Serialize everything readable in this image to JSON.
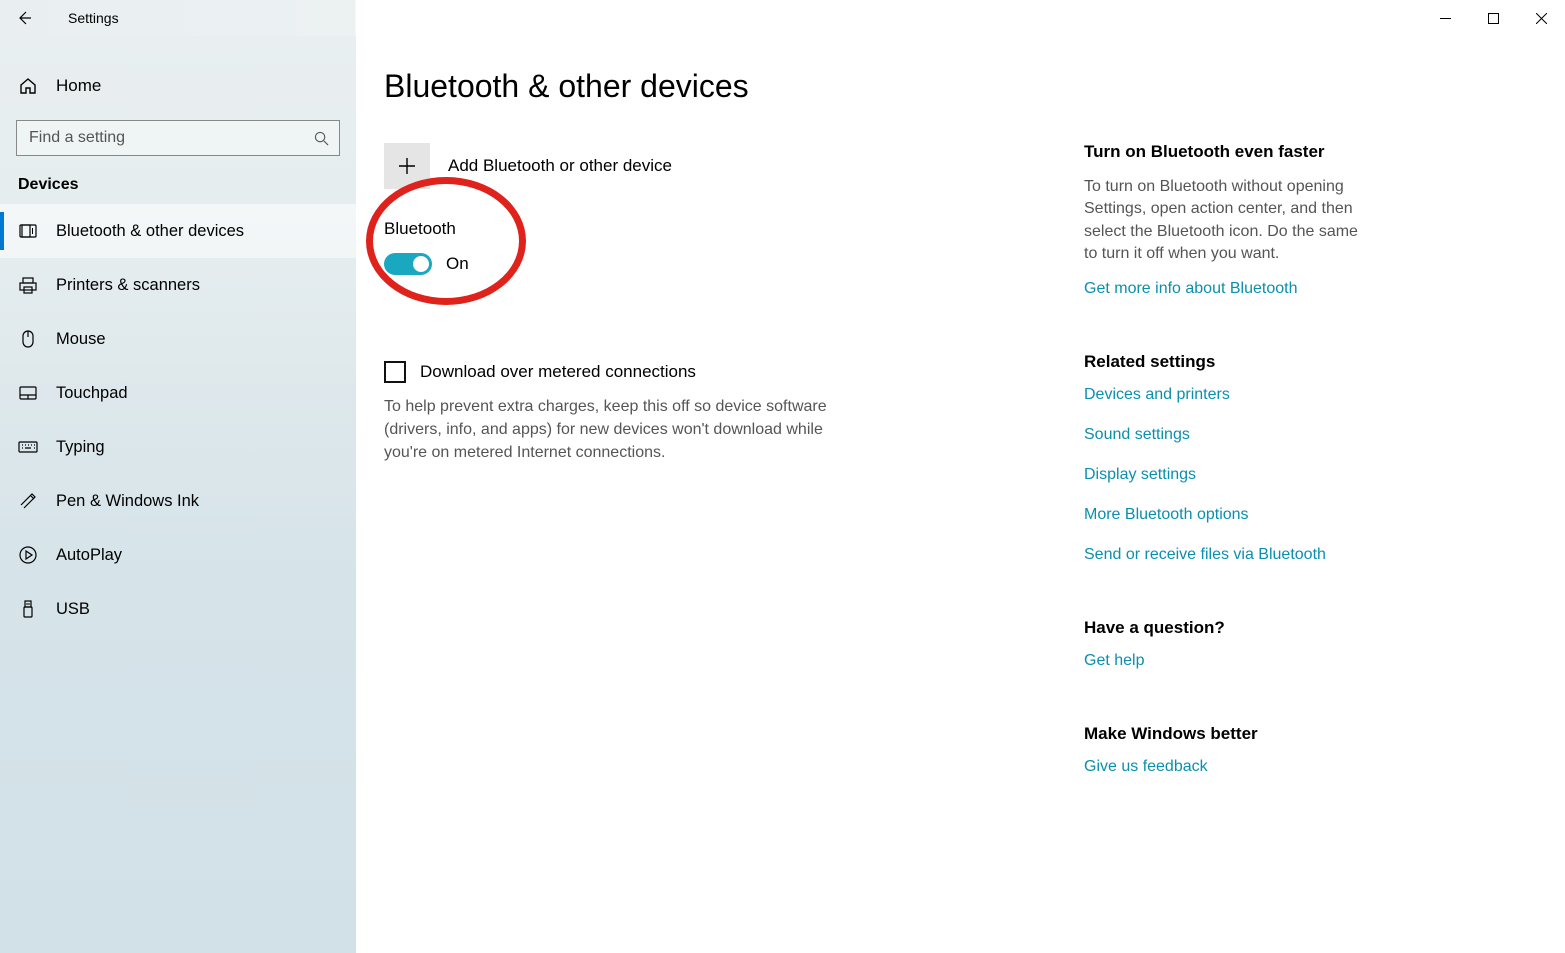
{
  "titlebar": {
    "title": "Settings"
  },
  "sidebar": {
    "home_label": "Home",
    "search_placeholder": "Find a setting",
    "category_label": "Devices",
    "items": [
      {
        "label": "Bluetooth & other devices",
        "active": true,
        "icon": "bluetooth"
      },
      {
        "label": "Printers & scanners",
        "active": false,
        "icon": "printer"
      },
      {
        "label": "Mouse",
        "active": false,
        "icon": "mouse"
      },
      {
        "label": "Touchpad",
        "active": false,
        "icon": "touchpad"
      },
      {
        "label": "Typing",
        "active": false,
        "icon": "keyboard"
      },
      {
        "label": "Pen & Windows Ink",
        "active": false,
        "icon": "pen"
      },
      {
        "label": "AutoPlay",
        "active": false,
        "icon": "autoplay"
      },
      {
        "label": "USB",
        "active": false,
        "icon": "usb"
      }
    ]
  },
  "page": {
    "title": "Bluetooth & other devices",
    "add_device_label": "Add Bluetooth or other device",
    "bluetooth_label": "Bluetooth",
    "bluetooth_on": true,
    "bluetooth_state_text": "On",
    "metered_check_label": "Download over metered connections",
    "metered_desc": "To help prevent extra charges, keep this off so device software (drivers, info, and apps) for new devices won't download while you're on metered Internet connections."
  },
  "right": {
    "sections": [
      {
        "heading": "Turn on Bluetooth even faster",
        "desc": "To turn on Bluetooth without opening Settings, open action center, and then select the Bluetooth icon. Do the same to turn it off when you want.",
        "links": [
          "Get more info about Bluetooth"
        ]
      },
      {
        "heading": "Related settings",
        "desc": "",
        "links": [
          "Devices and printers",
          "Sound settings",
          "Display settings",
          "More Bluetooth options",
          "Send or receive files via Bluetooth"
        ]
      },
      {
        "heading": "Have a question?",
        "desc": "",
        "links": [
          "Get help"
        ]
      },
      {
        "heading": "Make Windows better",
        "desc": "",
        "links": [
          "Give us feedback"
        ]
      }
    ]
  }
}
